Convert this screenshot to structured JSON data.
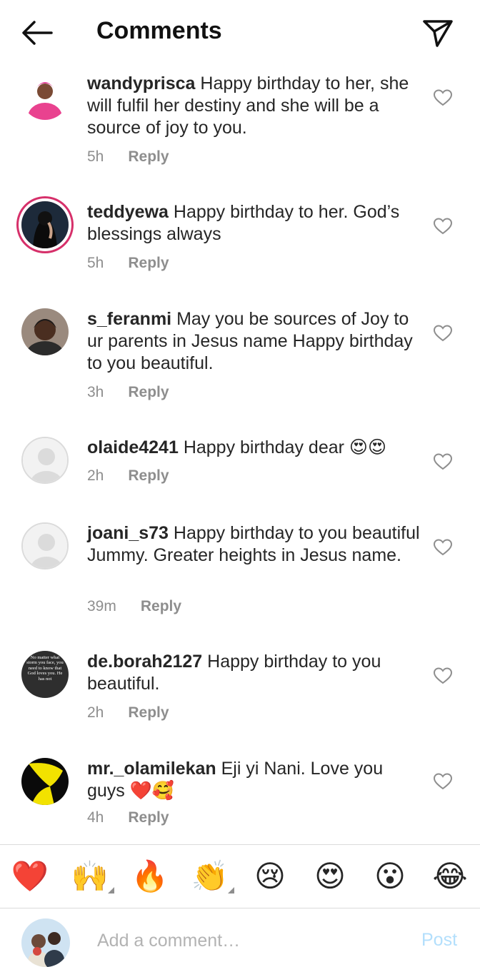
{
  "header": {
    "title": "Comments"
  },
  "comments": [
    {
      "username": "wandyprisca",
      "text": "Happy birthday to her, she will fulfil her destiny and she will be a source of joy to you.",
      "time": "5h",
      "reply": "Reply"
    },
    {
      "username": "teddyewa",
      "text": "Happy birthday to her. God’s blessings always",
      "time": "5h",
      "reply": "Reply"
    },
    {
      "username": "s_feranmi",
      "text": "May you be sources of Joy to ur parents in Jesus name Happy birthday to you beautiful.",
      "time": "3h",
      "reply": "Reply"
    },
    {
      "username": "olaide4241",
      "text": "Happy birthday dear 😍😍",
      "time": "2h",
      "reply": "Reply"
    },
    {
      "username": "joani_s73",
      "text": "Happy birthday to you beautiful Jummy. Greater heights in Jesus name.",
      "time": "39m",
      "reply": "Reply"
    },
    {
      "username": "de.borah2127",
      "text": "Happy birthday to you beautiful.",
      "time": "2h",
      "reply": "Reply",
      "avatar_text": "No matter what storm you face, you need to know that God loves you. He has not"
    },
    {
      "username": "mr._olamilekan",
      "text": "Eji yi Nani. Love you guys ❤️🥰",
      "time": "4h",
      "reply": "Reply"
    }
  ],
  "quick_reactions": [
    "❤️",
    "🙌",
    "🔥",
    "👏",
    "😢",
    "😍",
    "😮",
    "😂"
  ],
  "composer": {
    "placeholder": "Add a comment…",
    "post_label": "Post"
  },
  "colors": {
    "muted": "#8e8e8e",
    "text": "#262626",
    "post_disabled": "#b3dffc",
    "divider": "#dbdbdb"
  }
}
